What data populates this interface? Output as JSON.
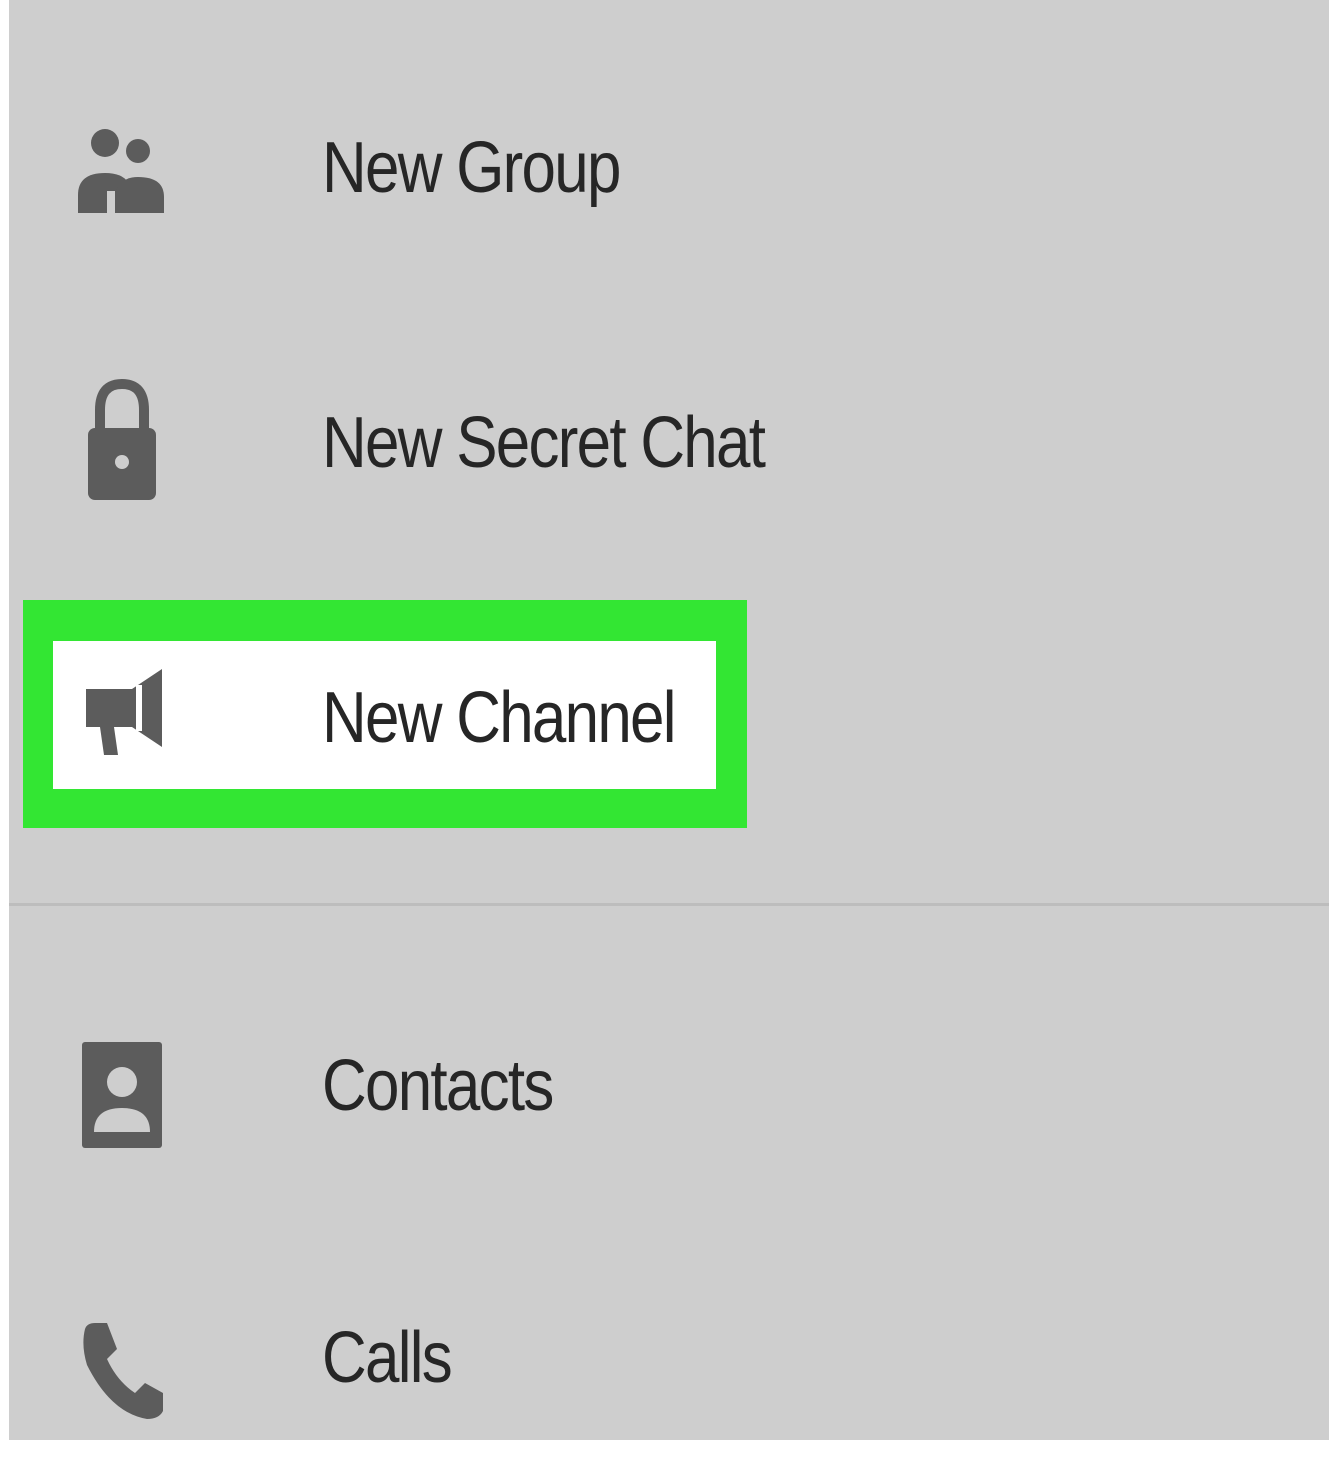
{
  "menu": {
    "items": [
      {
        "icon": "group-icon",
        "label": "New Group"
      },
      {
        "icon": "lock-icon",
        "label": "New Secret Chat"
      },
      {
        "icon": "megaphone-icon",
        "label": "New Channel",
        "highlighted": true
      },
      {
        "icon": "contact-card-icon",
        "label": "Contacts"
      },
      {
        "icon": "phone-icon",
        "label": "Calls"
      }
    ]
  },
  "colors": {
    "background": "#cecece",
    "icon": "#5c5c5c",
    "text": "#262626",
    "highlight": "#33e633",
    "highlight_fill": "#ffffff"
  }
}
